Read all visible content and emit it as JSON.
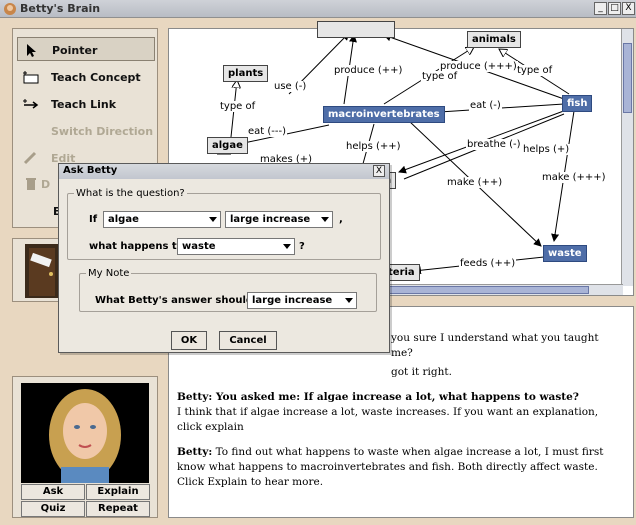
{
  "window": {
    "title": "Betty's Brain",
    "min": "_",
    "max": "□",
    "close": "X"
  },
  "toolbar": {
    "pointer": "Pointer",
    "teach_concept": "Teach Concept",
    "teach_link": "Teach Link",
    "switch_direction": "Switch Direction",
    "edit": "Edit",
    "delete_partial": "D",
    "e_partial": "E"
  },
  "concept_map": {
    "nodes": {
      "animals": "animals",
      "plants": "plants",
      "macroinvertebrates": "macroinvertebrates",
      "fish": "fish",
      "algae": "algae",
      "n_partial": "n",
      "waste": "waste",
      "bacteria_partial": "teria"
    },
    "links": {
      "use": "use (-)",
      "produce1": "produce (++)",
      "produce2": "produce (+++)",
      "type_of_1": "type of",
      "type_of_2": "type of",
      "type_of_3": "type of",
      "eat1": "eat (-)",
      "eat2": "eat (---)",
      "makes": "makes (+)",
      "helps1": "helps (++)",
      "breathe": "breathe (-)",
      "helps2": "helps (+)",
      "make1": "make (++)",
      "make2": "make (+++)",
      "feeds": "feeds (++)"
    }
  },
  "dialog": {
    "title": "Ask Betty",
    "close": "X",
    "question_legend": "What is the question?",
    "if_label": "If",
    "if_value": "algae",
    "change_value": "large increase",
    "comma": ",",
    "what_happens_label": "what happens to",
    "target_value": "waste",
    "qmark": "?",
    "note_legend": "My Note",
    "answer_label": "What Betty's answer should be:",
    "answer_value": "large increase",
    "ok": "OK",
    "cancel": "Cancel"
  },
  "conversation": {
    "line1": "you sure I understand what you taught me?",
    "line2": "got it right.",
    "q_speaker_line": "Betty: You asked me: If algae increase a lot, what happens to waste?",
    "q_answer": "I think that if algae increase a lot, waste increases. If you want an explanation, click explain",
    "speaker": "Betty:",
    "explanation": "To find out what happens to waste when algae increase a lot, I must first know what happens to macroinvertebrates and fish. Both directly affect waste. Click Explain to hear more."
  },
  "buttons": {
    "ask": "Ask",
    "explain": "Explain",
    "quiz": "Quiz",
    "repeat": "Repeat"
  }
}
